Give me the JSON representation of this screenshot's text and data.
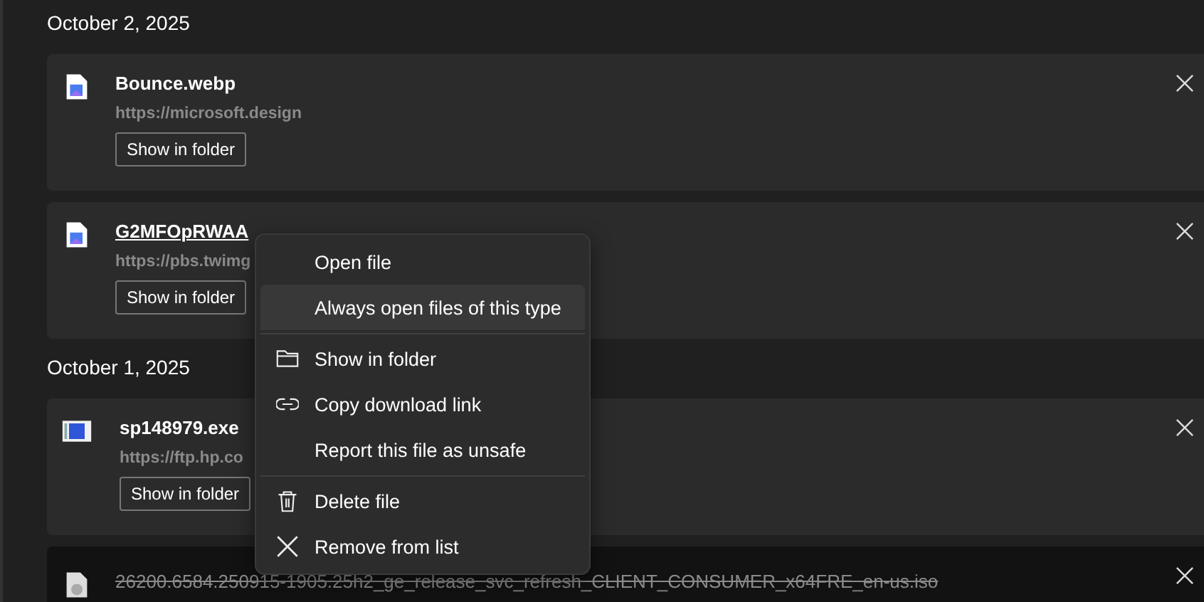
{
  "groups": [
    {
      "date": "October 2, 2025",
      "items": [
        {
          "kind": "image",
          "name": "Bounce.webp",
          "url": "https://microsoft.design",
          "button": "Show in folder",
          "deleted": false,
          "focused": false
        },
        {
          "kind": "image",
          "name": "G2MFOpRWAA",
          "url": "https://pbs.twimg",
          "button": "Show in folder",
          "deleted": false,
          "focused": true
        }
      ]
    },
    {
      "date": "October 1, 2025",
      "items": [
        {
          "kind": "exe",
          "name": "sp148979.exe",
          "url": "https://ftp.hp.co",
          "button": "Show in folder",
          "deleted": false,
          "focused": false
        },
        {
          "kind": "disc",
          "name": "26200.6584.250915-1905.25h2_ge_release_svc_refresh_CLIENT_CONSUMER_x64FRE_en-us.iso",
          "deleted": true,
          "focused": false
        }
      ]
    }
  ],
  "context_menu": {
    "items": [
      {
        "label": "Open file",
        "kind": "plain",
        "selected": false,
        "divider_after": false
      },
      {
        "label": "Always open files of this type",
        "kind": "plain",
        "selected": true,
        "divider_after": true
      },
      {
        "label": "Show in folder",
        "kind": "folder",
        "selected": false,
        "divider_after": false
      },
      {
        "label": "Copy download link",
        "kind": "link",
        "selected": false,
        "divider_after": false
      },
      {
        "label": "Report this file as unsafe",
        "kind": "plain",
        "selected": false,
        "divider_after": true
      },
      {
        "label": "Delete file",
        "kind": "trash",
        "selected": false,
        "divider_after": false
      },
      {
        "label": "Remove from list",
        "kind": "close",
        "selected": false,
        "divider_after": false
      }
    ]
  }
}
